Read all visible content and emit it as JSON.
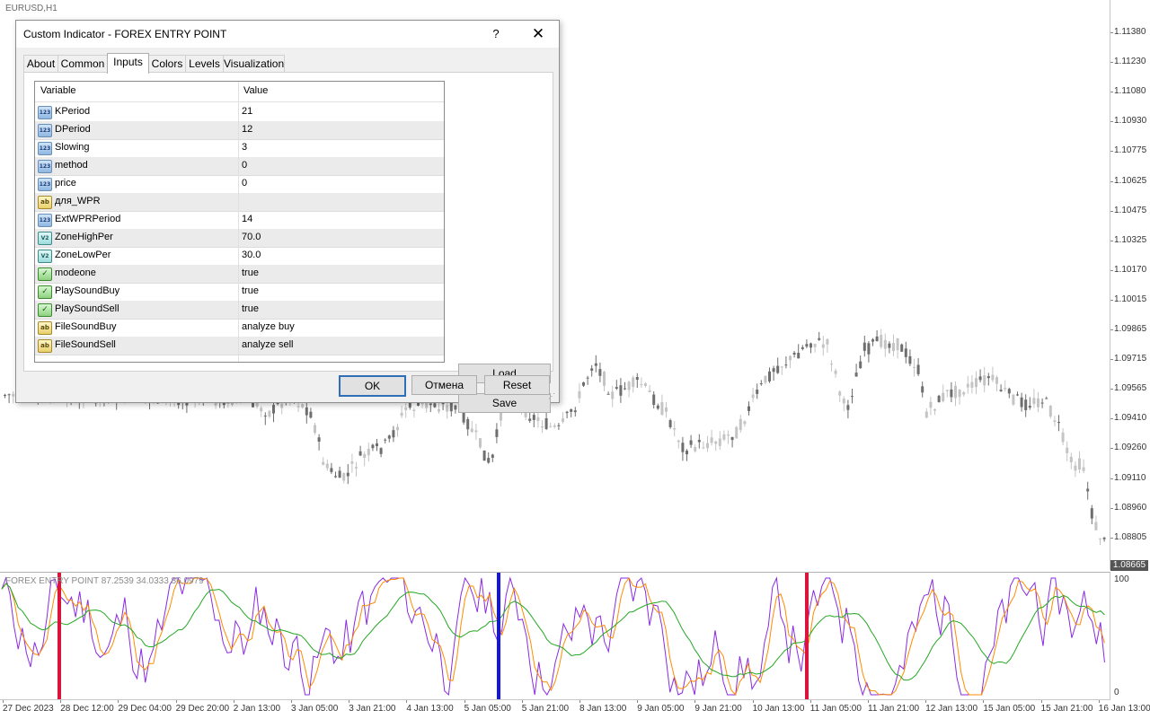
{
  "chart": {
    "symbol": "EURUSD,H1",
    "price_labels": [
      "1.11380",
      "1.11230",
      "1.11080",
      "1.10930",
      "1.10775",
      "1.10625",
      "1.10475",
      "1.10325",
      "1.10170",
      "1.10015",
      "1.09865",
      "1.09715",
      "1.09565",
      "1.09410",
      "1.09260",
      "1.09110",
      "1.08960",
      "1.08805"
    ],
    "current_price": "1.08665",
    "colors": {
      "bull": "#c4c4c4",
      "bear": "#6e6e6e",
      "background": "#ffffff"
    }
  },
  "indicator": {
    "label": "FOREX ENTRY POINT 87.2539 34.0333 86.0979",
    "scale_top": "100",
    "scale_bottom": "0",
    "colors": {
      "wpr": "#8a2be2",
      "k_line": "#ff8c00",
      "d_line": "#22a822",
      "sell_bar": "#dc143c",
      "buy_bar": "#1515e0"
    }
  },
  "time_axis": [
    "27 Dec 2023",
    "28 Dec 12:00",
    "29 Dec 04:00",
    "29 Dec 20:00",
    "2 Jan 13:00",
    "3 Jan 05:00",
    "3 Jan 21:00",
    "4 Jan 13:00",
    "5 Jan 05:00",
    "5 Jan 21:00",
    "8 Jan 13:00",
    "9 Jan 05:00",
    "9 Jan 21:00",
    "10 Jan 13:00",
    "11 Jan 05:00",
    "11 Jan 21:00",
    "12 Jan 13:00",
    "15 Jan 05:00",
    "15 Jan 21:00",
    "16 Jan 13:00"
  ],
  "dialog": {
    "title": "Custom Indicator - FOREX ENTRY POINT",
    "help_label": "?",
    "close_label": "✕",
    "tabs": [
      "About",
      "Common",
      "Inputs",
      "Colors",
      "Levels",
      "Visualization"
    ],
    "active_tab": "Inputs",
    "grid_headers": {
      "variable": "Variable",
      "value": "Value"
    },
    "rows": [
      {
        "icon": "int-icon",
        "badge": "123",
        "name": "KPeriod",
        "value": "21"
      },
      {
        "icon": "int-icon",
        "badge": "123",
        "name": "DPeriod",
        "value": "12"
      },
      {
        "icon": "int-icon",
        "badge": "123",
        "name": "Slowing",
        "value": "3"
      },
      {
        "icon": "int-icon",
        "badge": "123",
        "name": "method",
        "value": "0"
      },
      {
        "icon": "int-icon",
        "badge": "123",
        "name": "price",
        "value": "0"
      },
      {
        "icon": "string-icon",
        "badge": "ab",
        "name": "для_WPR",
        "value": ""
      },
      {
        "icon": "int-icon",
        "badge": "123",
        "name": "ExtWPRPeriod",
        "value": "14"
      },
      {
        "icon": "double-icon",
        "badge": "V2",
        "name": "ZoneHighPer",
        "value": "70.0"
      },
      {
        "icon": "double-icon",
        "badge": "V2",
        "name": "ZoneLowPer",
        "value": "30.0"
      },
      {
        "icon": "bool-icon",
        "badge": "✓",
        "name": "modeone",
        "value": "true"
      },
      {
        "icon": "bool-icon",
        "badge": "✓",
        "name": "PlaySoundBuy",
        "value": "true"
      },
      {
        "icon": "bool-icon",
        "badge": "✓",
        "name": "PlaySoundSell",
        "value": "true"
      },
      {
        "icon": "string-icon",
        "badge": "ab",
        "name": "FileSoundBuy",
        "value": "analyze buy"
      },
      {
        "icon": "string-icon",
        "badge": "ab",
        "name": "FileSoundSell",
        "value": "analyze sell"
      }
    ],
    "buttons": {
      "load": "Load",
      "save": "Save",
      "ok": "OK",
      "cancel": "Отмена",
      "reset": "Reset"
    }
  }
}
